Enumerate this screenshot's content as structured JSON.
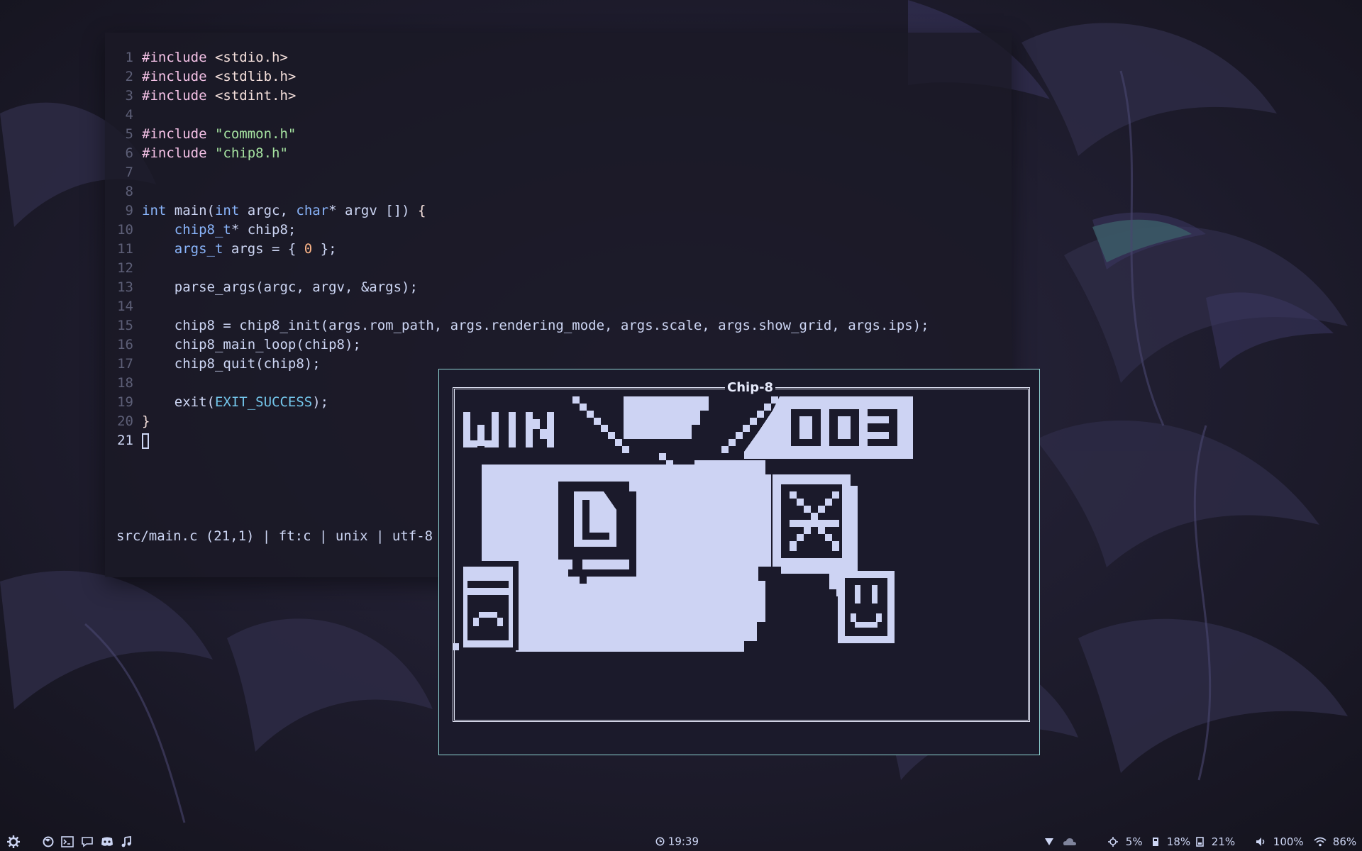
{
  "editor": {
    "lines": [
      {
        "n": "1",
        "segs": [
          [
            "kw",
            "#include "
          ],
          [
            "pn",
            "<stdio.h>"
          ]
        ]
      },
      {
        "n": "2",
        "segs": [
          [
            "kw",
            "#include "
          ],
          [
            "pn",
            "<stdlib.h>"
          ]
        ]
      },
      {
        "n": "3",
        "segs": [
          [
            "kw",
            "#include "
          ],
          [
            "pn",
            "<stdint.h>"
          ]
        ]
      },
      {
        "n": "4",
        "segs": []
      },
      {
        "n": "5",
        "segs": [
          [
            "kw",
            "#include "
          ],
          [
            "str",
            "\"common.h\""
          ]
        ]
      },
      {
        "n": "6",
        "segs": [
          [
            "kw",
            "#include "
          ],
          [
            "str",
            "\"chip8.h\""
          ]
        ]
      },
      {
        "n": "7",
        "segs": []
      },
      {
        "n": "8",
        "segs": []
      },
      {
        "n": "9",
        "segs": [
          [
            "type",
            "int"
          ],
          [
            "",
            " main("
          ],
          [
            "type",
            "int"
          ],
          [
            "",
            " argc, "
          ],
          [
            "type",
            "char"
          ],
          [
            "",
            "* argv []) "
          ],
          [
            "pn",
            "{"
          ]
        ]
      },
      {
        "n": "10",
        "segs": [
          [
            "",
            "    "
          ],
          [
            "type",
            "chip8_t"
          ],
          [
            "",
            "* chip8;"
          ]
        ]
      },
      {
        "n": "11",
        "segs": [
          [
            "",
            "    "
          ],
          [
            "type",
            "args_t"
          ],
          [
            "",
            " args = { "
          ],
          [
            "num",
            "0"
          ],
          [
            "",
            " };"
          ]
        ]
      },
      {
        "n": "12",
        "segs": []
      },
      {
        "n": "13",
        "segs": [
          [
            "",
            "    parse_args(argc, argv, &args);"
          ]
        ]
      },
      {
        "n": "14",
        "segs": []
      },
      {
        "n": "15",
        "segs": [
          [
            "",
            "    chip8 = chip8_init(args.rom_path, args.rendering_mode, args.scale, args.show_grid, args.ips);"
          ]
        ]
      },
      {
        "n": "16",
        "segs": [
          [
            "",
            "    chip8_main_loop(chip8);"
          ]
        ]
      },
      {
        "n": "17",
        "segs": [
          [
            "",
            "    chip8_quit(chip8);"
          ]
        ]
      },
      {
        "n": "18",
        "segs": []
      },
      {
        "n": "19",
        "segs": [
          [
            "",
            "    exit("
          ],
          [
            "const",
            "EXIT_SUCCESS"
          ],
          [
            "",
            ");"
          ]
        ]
      },
      {
        "n": "20",
        "segs": [
          [
            "pn",
            "}"
          ]
        ]
      },
      {
        "n": "21",
        "segs": [],
        "cursor": true
      }
    ],
    "status": "src/main.c (21,1) | ft:c | unix | utf-8"
  },
  "chip8": {
    "title": "Chip-8"
  },
  "bar": {
    "left_icons": [
      "gear-icon",
      "firefox-icon",
      "terminal-icon",
      "chat-icon",
      "discord-icon",
      "music-icon"
    ],
    "clock": "19:39",
    "cpu": "5%",
    "memory": "18%",
    "disk": "21%",
    "volume": "100%",
    "wifi": "86%"
  },
  "colors": {
    "accent": "#8fd3d3",
    "keyword": "#f5c2e7",
    "string": "#a6e3a1",
    "type": "#89b4fa",
    "number": "#fab387",
    "pixel_on": "#cdd3f3",
    "pixel_off": "#1b1a2b"
  }
}
